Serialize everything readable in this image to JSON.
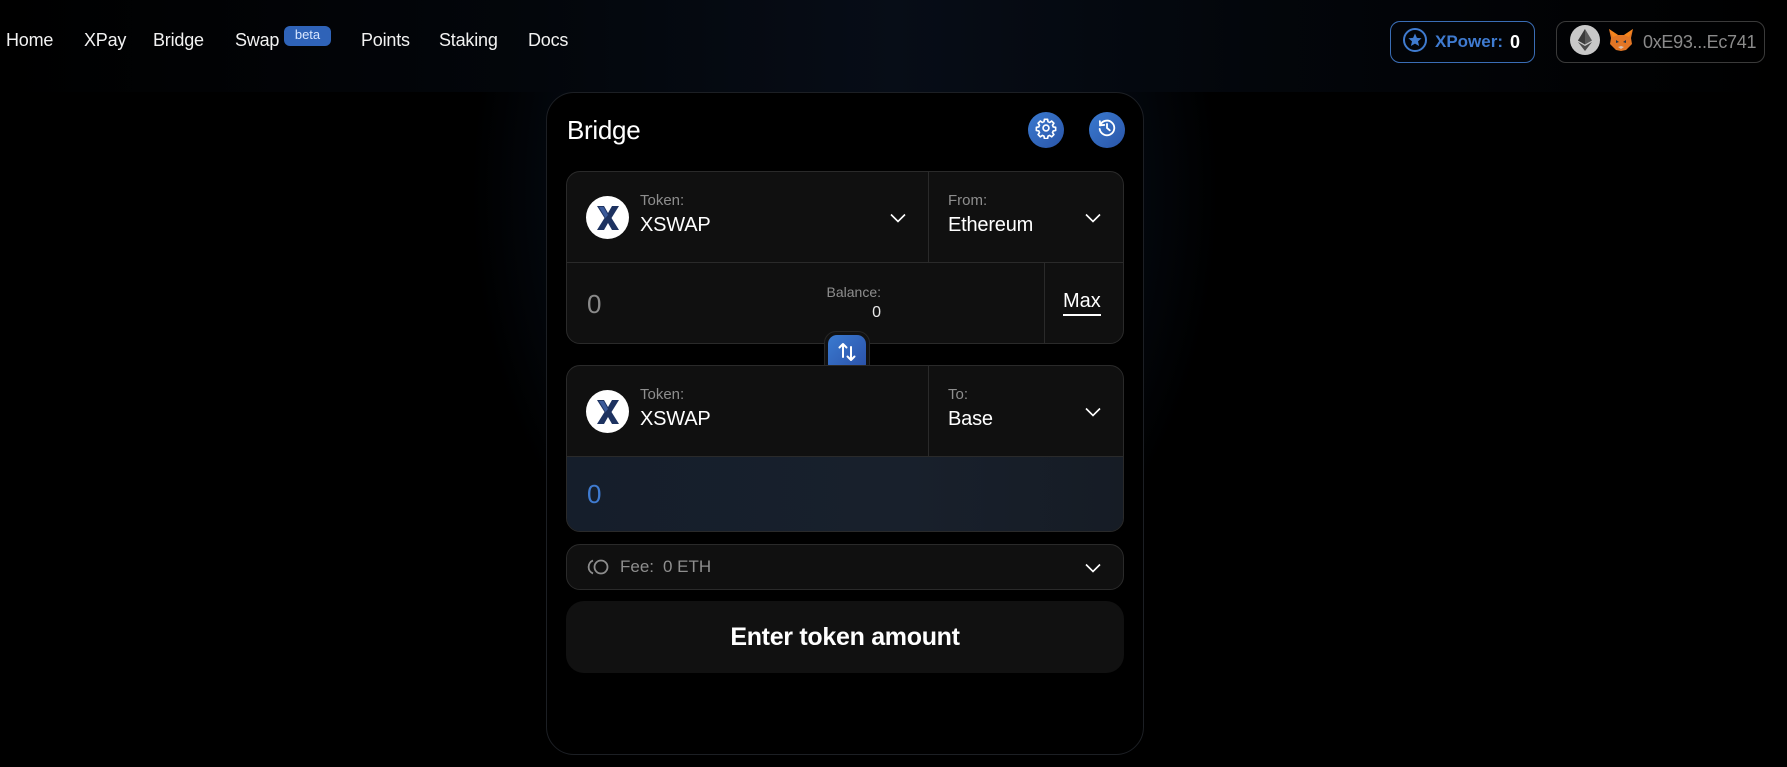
{
  "nav": {
    "items": [
      {
        "label": "Home"
      },
      {
        "label": "XPay"
      },
      {
        "label": "Bridge"
      },
      {
        "label": "Swap",
        "badge": "beta"
      },
      {
        "label": "Points"
      },
      {
        "label": "Staking"
      },
      {
        "label": "Docs"
      }
    ]
  },
  "header": {
    "xpower": {
      "label": "XPower:",
      "value": "0",
      "icon": "star-circle-icon"
    },
    "wallet": {
      "network_icon": "ethereum-icon",
      "wallet_icon": "metamask-fox-icon",
      "address": "0xE93...Ec741"
    }
  },
  "bridge": {
    "title": "Bridge",
    "settings_icon": "gear-icon",
    "history_icon": "history-icon",
    "source": {
      "token_label": "Token:",
      "token": "XSWAP",
      "chain_label": "From:",
      "chain": "Ethereum",
      "amount": "0",
      "balance_label": "Balance:",
      "balance": "0",
      "max_label": "Max"
    },
    "destination": {
      "token_label": "Token:",
      "token": "XSWAP",
      "chain_label": "To:",
      "chain": "Base",
      "amount": "0"
    },
    "fee": {
      "label": "Fee:",
      "value": "0 ETH"
    },
    "cta_label": "Enter token amount"
  },
  "colors": {
    "accent": "#3a7ad0",
    "xpower": "#3f7bd0",
    "receive_amount": "#3f7bd0",
    "panel_bg": "#101010",
    "page_bg": "#000000"
  }
}
